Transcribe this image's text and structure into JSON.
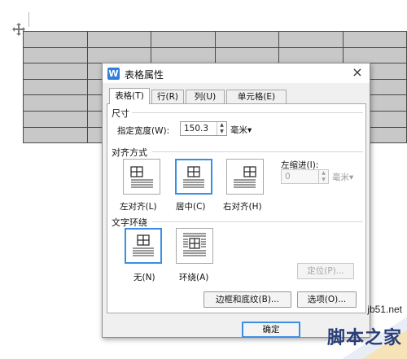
{
  "dialog": {
    "title": "表格属性",
    "close_symbol": "×",
    "tabs": [
      {
        "label": "表格(T)",
        "active": true
      },
      {
        "label": "行(R)",
        "active": false
      },
      {
        "label": "列(U)",
        "active": false
      },
      {
        "label": "单元格(E)",
        "active": false
      }
    ],
    "size": {
      "section_title": "尺寸",
      "width_label": "指定宽度(W):",
      "width_value": "150.3",
      "width_unit": "毫米"
    },
    "alignment": {
      "section_title": "对齐方式",
      "options": [
        {
          "label": "左对齐(L)",
          "icon": "align-left-icon",
          "selected": false
        },
        {
          "label": "居中(C)",
          "icon": "align-center-icon",
          "selected": true
        },
        {
          "label": "右对齐(H)",
          "icon": "align-right-icon",
          "selected": false
        }
      ],
      "indent_label": "左缩进(I):",
      "indent_value": "0",
      "indent_unit": "毫米"
    },
    "wrap": {
      "section_title": "文字环绕",
      "options": [
        {
          "label": "无(N)",
          "icon": "wrap-none-icon",
          "selected": true
        },
        {
          "label": "环绕(A)",
          "icon": "wrap-around-icon",
          "selected": false
        }
      ],
      "position_button": "定位(P)..."
    },
    "buttons": {
      "borders_shading": "边框和底纹(B)...",
      "options": "选项(O)...",
      "ok": "确定"
    }
  },
  "watermark": {
    "site": "jb51.net",
    "name": "脚本之家"
  },
  "colors": {
    "accent": "#3b8ee4",
    "table_fill": "#c8c8c8",
    "watermark": "#2a3e78"
  }
}
